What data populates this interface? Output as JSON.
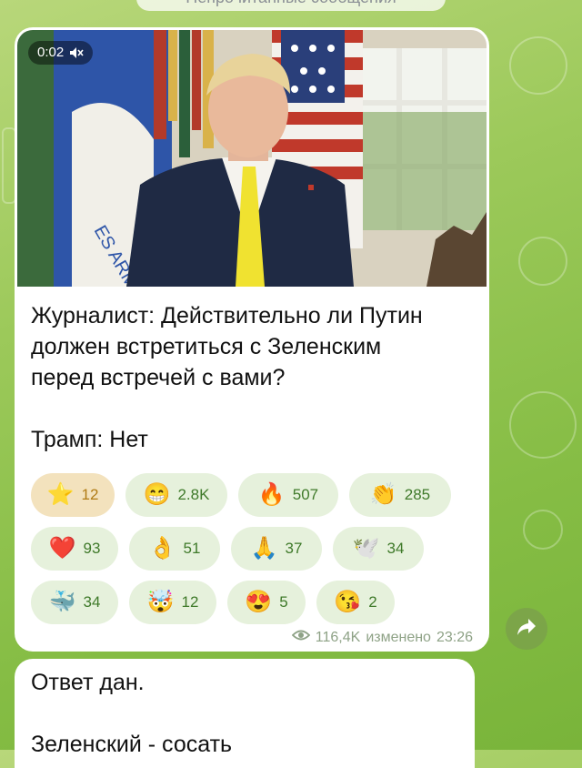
{
  "banner": {
    "text": "Непрочитанные сообщения"
  },
  "video": {
    "duration": "0:02",
    "muted_icon": "speaker-muted-icon"
  },
  "message": {
    "line1": "Журналист: Действительно ли Путин",
    "line2": "должен встретиться с Зеленским",
    "line3": "перед встречей с вами?",
    "line4": "Трамп: Нет"
  },
  "reactions": [
    {
      "emoji": "⭐",
      "count": "12",
      "active": true
    },
    {
      "emoji": "😁",
      "count": "2.8K"
    },
    {
      "emoji": "🔥",
      "count": "507"
    },
    {
      "emoji": "👏",
      "count": "285"
    },
    {
      "emoji": "❤️",
      "count": "93"
    },
    {
      "emoji": "👌",
      "count": "51"
    },
    {
      "emoji": "🙏",
      "count": "37"
    },
    {
      "emoji": "🕊️",
      "count": "34"
    },
    {
      "emoji": "🐳",
      "count": "34"
    },
    {
      "emoji": "🤯",
      "count": "12"
    },
    {
      "emoji": "😍",
      "count": "5"
    },
    {
      "emoji": "😘",
      "count": "2"
    }
  ],
  "meta": {
    "views": "116,4K",
    "edited": "изменено",
    "time": "23:26"
  },
  "colors": {
    "accent": "#3f7a2a",
    "star_highlight": "#b07b14",
    "pill_bg": "#e6f1dc"
  },
  "next_message": {
    "line1": "Ответ дан.",
    "line2": "Зеленский - сосать"
  }
}
